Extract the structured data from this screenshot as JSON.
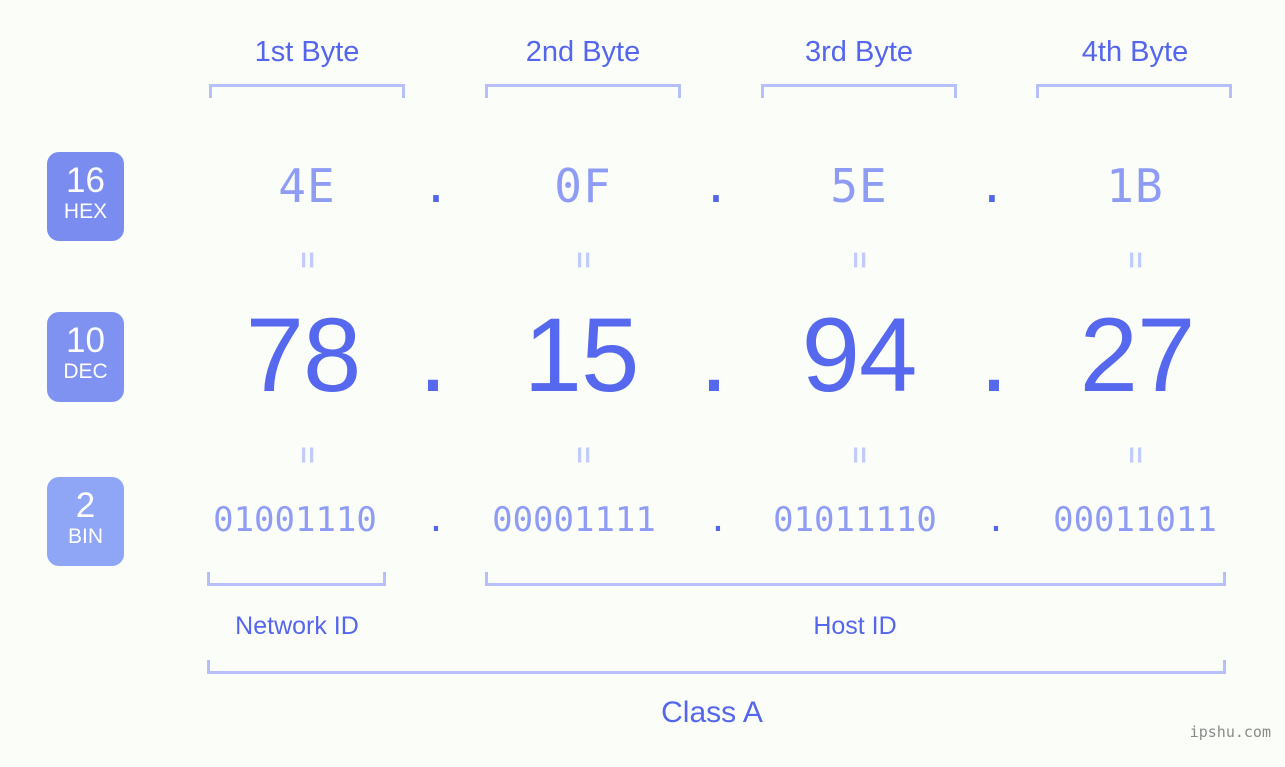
{
  "meta": {
    "watermark": "ipshu.com"
  },
  "colors": {
    "background": "#fbfdf8",
    "accent_strong": "#5566ee",
    "accent_mid": "#8f9cf5",
    "accent_light": "#b6bffa",
    "badge_hex": "#7b8cf0",
    "badge_dec": "#7f92f2",
    "badge_bin": "#8fa6f7",
    "watermark_gray": "#8a8a8a"
  },
  "header": {
    "byte_labels": [
      "1st Byte",
      "2nd Byte",
      "3rd Byte",
      "4th Byte"
    ]
  },
  "bases": [
    {
      "number": "16",
      "abbr": "HEX"
    },
    {
      "number": "10",
      "abbr": "DEC"
    },
    {
      "number": "2",
      "abbr": "BIN"
    }
  ],
  "separators": {
    "dot": ".",
    "equals": "="
  },
  "rows": {
    "hex": {
      "base_number": "16",
      "base_abbr": "HEX",
      "values": [
        "4E",
        "0F",
        "5E",
        "1B"
      ]
    },
    "dec": {
      "base_number": "10",
      "base_abbr": "DEC",
      "values": [
        "78",
        "15",
        "94",
        "27"
      ]
    },
    "bin": {
      "base_number": "2",
      "base_abbr": "BIN",
      "values": [
        "01001110",
        "00001111",
        "01011110",
        "00011011"
      ]
    }
  },
  "footer": {
    "network_id_label": "Network ID",
    "host_id_label": "Host ID",
    "class_label": "Class A"
  }
}
